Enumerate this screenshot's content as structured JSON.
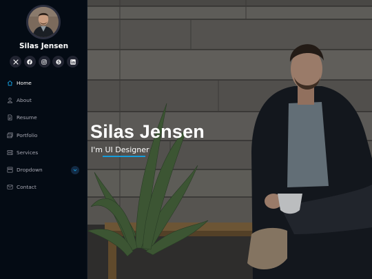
{
  "profile": {
    "name": "Silas Jensen"
  },
  "socials": [
    {
      "icon": "x-twitter-icon"
    },
    {
      "icon": "facebook-icon"
    },
    {
      "icon": "instagram-icon"
    },
    {
      "icon": "skype-icon"
    },
    {
      "icon": "linkedin-icon"
    }
  ],
  "nav": {
    "items": [
      {
        "label": "Home",
        "icon": "home-icon",
        "active": true
      },
      {
        "label": "About",
        "icon": "person-icon"
      },
      {
        "label": "Resume",
        "icon": "file-text-icon"
      },
      {
        "label": "Portfolio",
        "icon": "images-icon"
      },
      {
        "label": "Services",
        "icon": "hdd-stack-icon"
      },
      {
        "label": "Dropdown",
        "icon": "menu-app-icon",
        "has_submenu": true
      },
      {
        "label": "Contact",
        "icon": "envelope-icon"
      }
    ]
  },
  "hero": {
    "title": "Silas Jensen",
    "subtitle": "I'm UI Designer"
  },
  "colors": {
    "sidebar_bg": "#040b14",
    "accent": "#149ddd",
    "nav_text": "#a8a9b4",
    "social_bg": "#212431"
  }
}
